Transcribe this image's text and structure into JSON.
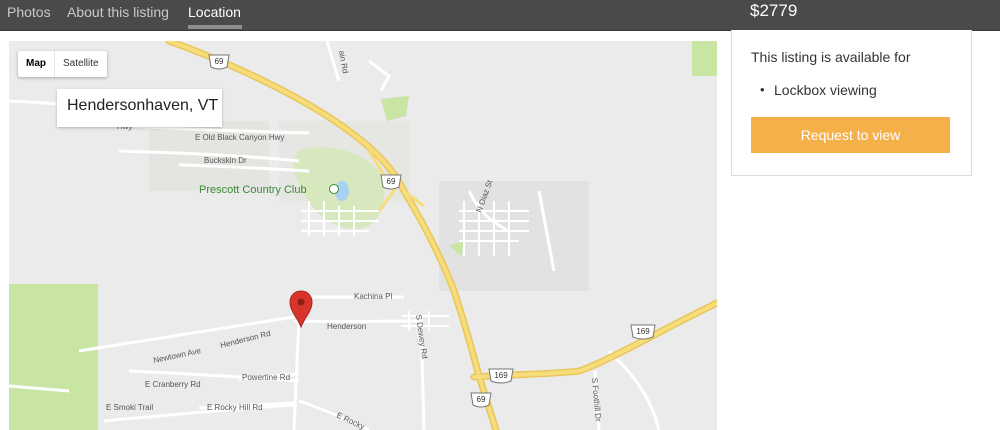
{
  "nav": {
    "tabs": [
      {
        "label": "Photos",
        "active": false
      },
      {
        "label": "About this listing",
        "active": false
      },
      {
        "label": "Location",
        "active": true
      }
    ],
    "price": "$2779"
  },
  "map": {
    "type_controls": {
      "map_label": "Map",
      "satellite_label": "Satellite",
      "selected": "Map"
    },
    "location_label": "Hendersonhaven, VT",
    "place_label": "Prescott Country Club",
    "highway_shields": [
      "69",
      "69",
      "169",
      "169",
      "69"
    ],
    "road_labels": [
      "ain Rd",
      "Hwy",
      "E Old Black Canyon Hwy",
      "Buckskin Dr",
      "N Diaz St",
      "Kachina Pl",
      "Henderson",
      "Newtown Ave",
      "Henderson Rd",
      "S Dewey Rd",
      "E Cranberry Rd",
      "Powertine Rd",
      "E Smoki Trail",
      "E Rocky Hill Rd",
      "E Rocky",
      "S Foothill Dr"
    ],
    "colors": {
      "highway": "#f5d56b",
      "park": "#c8e5a4",
      "marker": "#d9342b"
    }
  },
  "panel": {
    "heading": "This listing is available for",
    "options": [
      "Lockbox viewing"
    ],
    "button_label": "Request to view",
    "button_color": "#f5b04a"
  }
}
